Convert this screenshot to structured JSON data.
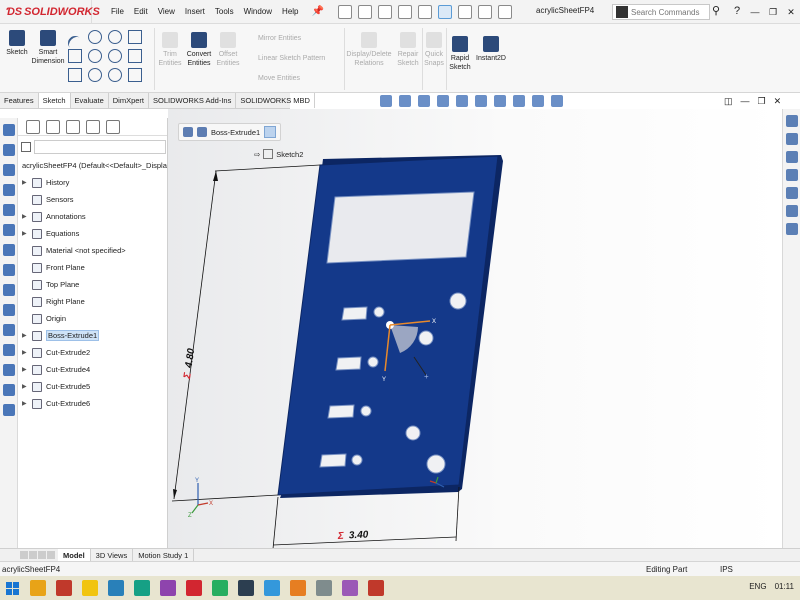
{
  "app": {
    "brand": "SOLIDWORKS",
    "document_title": "acrylicSheetFP4"
  },
  "menu": [
    "File",
    "Edit",
    "View",
    "Insert",
    "Tools",
    "Window",
    "Help"
  ],
  "search": {
    "placeholder": "Search Commands"
  },
  "ribbon": {
    "sketch": "Sketch",
    "smart_dimension": "Smart Dimension",
    "trim_entities": "Trim Entities",
    "convert_entities": "Convert Entities",
    "offset_entities": "Offset Entities",
    "mirror_entities": "Mirror Entities",
    "linear_sketch_pattern": "Linear Sketch Pattern",
    "move_entities": "Move Entities",
    "display_delete_relations": "Display/Delete Relations",
    "repair_sketch": "Repair Sketch",
    "quick_snaps": "Quick Snaps",
    "rapid_sketch": "Rapid Sketch",
    "instant2d": "Instant2D"
  },
  "tabs": [
    "Features",
    "Sketch",
    "Evaluate",
    "DimXpert",
    "SOLIDWORKS Add-Ins",
    "SOLIDWORKS MBD"
  ],
  "active_tab": "Sketch",
  "tree": {
    "root": "acrylicSheetFP4  (Default<<Default>_Displa",
    "items": [
      {
        "label": "History",
        "expand": true
      },
      {
        "label": "Sensors",
        "expand": false
      },
      {
        "label": "Annotations",
        "expand": true
      },
      {
        "label": "Equations",
        "expand": true
      },
      {
        "label": "Material <not specified>",
        "expand": false
      },
      {
        "label": "Front Plane",
        "expand": false
      },
      {
        "label": "Top Plane",
        "expand": false
      },
      {
        "label": "Right Plane",
        "expand": false
      },
      {
        "label": "Origin",
        "expand": false
      },
      {
        "label": "Boss-Extrude1",
        "expand": true,
        "highlight": true
      },
      {
        "label": "Cut-Extrude2",
        "expand": true
      },
      {
        "label": "Cut-Extrude4",
        "expand": true
      },
      {
        "label": "Cut-Extrude5",
        "expand": true
      },
      {
        "label": "Cut-Extrude6",
        "expand": true
      }
    ]
  },
  "breadcrumb": {
    "feature": "Boss-Extrude1",
    "sketch": "Sketch2"
  },
  "dimensions": {
    "height": "4.80",
    "width": "3.40"
  },
  "bottom_tabs": [
    "Model",
    "3D Views",
    "Motion Study 1"
  ],
  "status": {
    "left": "acrylicSheetFP4",
    "mode": "Editing Part",
    "units": "IPS"
  },
  "tray": {
    "lang": "ENG",
    "time": "01:11"
  },
  "colors": {
    "plate": "#14398a",
    "plate_edge": "#0c2663",
    "accent": "#d22630"
  }
}
